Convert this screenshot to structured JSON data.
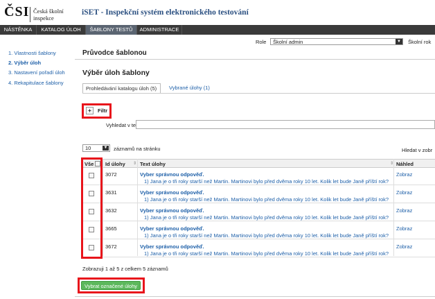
{
  "logo": {
    "mark": "ČSI",
    "line1": "Česká školní",
    "line2": "inspekce"
  },
  "app_title": "iSET - Inspekční systém elektronického testování",
  "nav": [
    "NÁSTĚNKA",
    "KATALOG ÚLOH",
    "ŠABLONY TESTŮ",
    "ADMINISTRACE"
  ],
  "sidebar": [
    "1. Vlastnosti šablony",
    "2. Výběr úloh",
    "3. Nastavení pořadí úloh",
    "4. Rekapitulace šablony"
  ],
  "role": {
    "label": "Role",
    "value": "Školní admin",
    "next": "Školní rok"
  },
  "page_title": "Průvodce šablonou",
  "section_title": "Výběr úloh šablony",
  "tabs": [
    "Prohledávání katalogu úloh (5)",
    "Vybrané úlohy (1)"
  ],
  "filter": {
    "label": "Filtr",
    "search_label": "Vyhledat v textu:"
  },
  "page_length": {
    "value": "10",
    "label": "záznamů na stránku"
  },
  "find_label": "Hledat v zobr",
  "table": {
    "headers": [
      "Vše",
      "Id úlohy",
      "Text úlohy",
      "Náhled"
    ],
    "rows": [
      {
        "id": "3072",
        "title": "Vyber správnou odpověď.",
        "text": "1) Jana je o tři roky starší než Martin. Martinovi bylo před dvěma roky 10 let. Kolik let bude Janě příští rok?",
        "view": "Zobraz"
      },
      {
        "id": "3631",
        "title": "Vyber správnou odpověď.",
        "text": "1) Jana je o tři roky starší než Martin. Martinovi bylo před dvěma roky 10 let. Kolik let bude Janě příští rok?",
        "view": "Zobraz"
      },
      {
        "id": "3632",
        "title": "Vyber správnou odpověď.",
        "text": "1) Jana je o tři roky starší než Martin. Martinovi bylo před dvěma roky 10 let. Kolik let bude Janě příští rok?",
        "view": "Zobraz"
      },
      {
        "id": "3665",
        "title": "Vyber správnou odpověď.",
        "text": "1) Jana je o tři roky starší než Martin. Martinovi bylo před dvěma roky 10 let. Kolik let bude Janě příští rok?",
        "view": "Zobraz"
      },
      {
        "id": "3672",
        "title": "Vyber správnou odpověď.",
        "text": "1) Jana je o tři roky starší než Martin. Martinovi bylo před dvěma roky 10 let. Kolik let bude Janě příští rok?",
        "view": "Zobraz"
      }
    ]
  },
  "info": "Zobrazuji 1 až 5 z celkem 5 záznamů",
  "select_button": "Vybrat označené úlohy",
  "colors": {
    "nav_bg": "#3a3a3a",
    "link": "#1d5fa8",
    "highlight": "#e8141b",
    "button": "#5cb85c"
  }
}
